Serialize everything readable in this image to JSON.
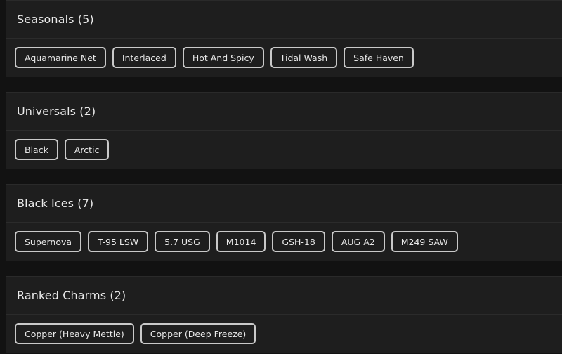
{
  "sections": [
    {
      "title": "Seasonals (5)",
      "items": [
        "Aquamarine Net",
        "Interlaced",
        "Hot And Spicy",
        "Tidal Wash",
        "Safe Haven"
      ]
    },
    {
      "title": "Universals (2)",
      "items": [
        "Black",
        "Arctic"
      ]
    },
    {
      "title": "Black Ices (7)",
      "items": [
        "Supernova",
        "T-95 LSW",
        "5.7 USG",
        "M1014",
        "GSH-18",
        "AUG A2",
        "M249 SAW"
      ]
    },
    {
      "title": "Ranked Charms (2)",
      "items": [
        "Copper (Heavy Mettle)",
        "Copper (Deep Freeze)"
      ]
    }
  ]
}
